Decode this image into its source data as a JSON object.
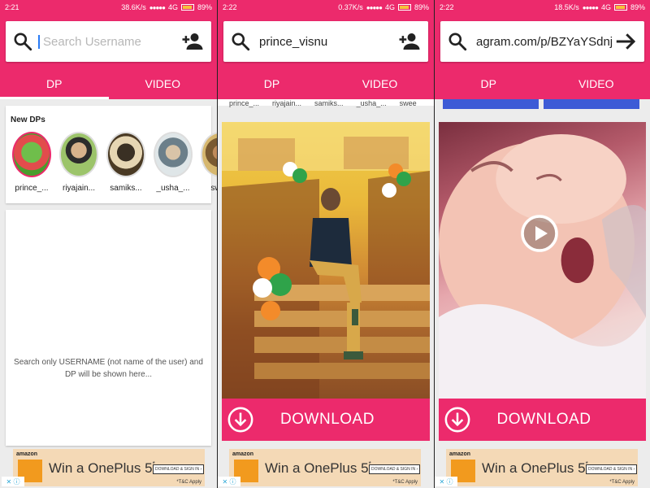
{
  "screens": [
    {
      "status": {
        "time": "2:21",
        "speed": "38.6K/s",
        "network": "4G",
        "battery": "89%"
      },
      "search": {
        "value": "",
        "placeholder": "Search Username",
        "action_icon": "add-person-icon"
      },
      "tabs": [
        {
          "label": "DP",
          "active": true
        },
        {
          "label": "VIDEO",
          "active": false
        }
      ],
      "new_dps": {
        "title": "New DPs",
        "items": [
          {
            "name": "prince_..."
          },
          {
            "name": "riyajain..."
          },
          {
            "name": "samiks..."
          },
          {
            "name": "_usha_..."
          },
          {
            "name": "swee"
          }
        ]
      },
      "hint": "Search only USERNAME (not name of the user) and DP will be shown here...",
      "ad": {
        "brand": "amazon",
        "headline": "Win a OnePlus 5",
        "sup": "*",
        "cta": "DOWNLOAD & SIGN IN ›",
        "tc": "*T&C Apply"
      }
    },
    {
      "status": {
        "time": "2:22",
        "speed": "0.37K/s",
        "network": "4G",
        "battery": "89%"
      },
      "search": {
        "value": "prince_visnu",
        "placeholder": "",
        "action_icon": "add-person-icon"
      },
      "tabs": [
        {
          "label": "DP",
          "active": false
        },
        {
          "label": "VIDEO",
          "active": false
        }
      ],
      "strip_names": [
        "prince_...",
        "riyajain...",
        "samiks...",
        "_usha_...",
        "swee"
      ],
      "download": {
        "label": "DOWNLOAD",
        "icon": "download-circle-icon"
      },
      "ad": {
        "brand": "amazon",
        "headline": "Win a OnePlus 5",
        "sup": "*",
        "cta": "DOWNLOAD & SIGN IN ›",
        "tc": "*T&C Apply"
      }
    },
    {
      "status": {
        "time": "2:22",
        "speed": "18.5K/s",
        "network": "4G",
        "battery": "89%"
      },
      "search": {
        "value": "agram.com/p/BZYaYSdnjDd/",
        "placeholder": "",
        "action_icon": "arrow-right-icon"
      },
      "tabs": [
        {
          "label": "DP",
          "active": false
        },
        {
          "label": "VIDEO",
          "active": false
        }
      ],
      "download": {
        "label": "DOWNLOAD",
        "icon": "download-circle-icon"
      },
      "play_icon": "play-icon",
      "ad": {
        "brand": "amazon",
        "headline": "Win a OnePlus 5",
        "sup": "*",
        "cta": "DOWNLOAD & SIGN IN ›",
        "tc": "*T&C Apply"
      }
    }
  ],
  "colors": {
    "accent": "#ec2a6c",
    "ad_bg": "#f4d9b6",
    "cursor": "#2a7cf6"
  }
}
